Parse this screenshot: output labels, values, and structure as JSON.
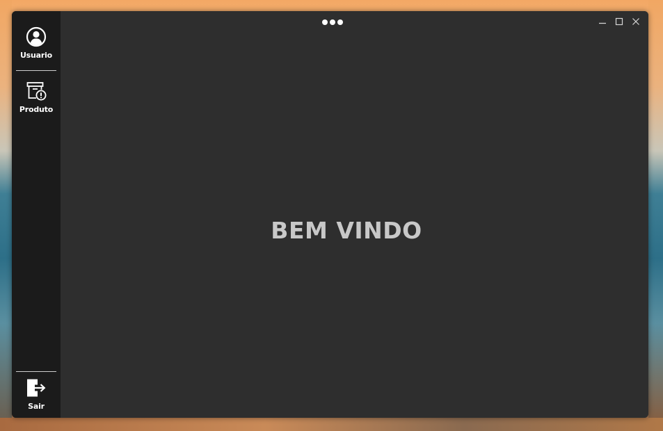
{
  "sidebar": {
    "items": [
      {
        "label": "Usuario",
        "icon": "user-circle-icon"
      },
      {
        "label": "Produto",
        "icon": "product-box-alert-icon"
      }
    ],
    "footer": {
      "label": "Sair",
      "icon": "logout-icon"
    }
  },
  "header": {
    "more_icon": "more-dots-icon",
    "window_controls": [
      "minimize-icon",
      "maximize-icon",
      "close-icon"
    ]
  },
  "main": {
    "welcome_text": "BEM VINDO"
  },
  "colors": {
    "sidebar_bg": "#1b1b1b",
    "content_bg": "#2e2e2e",
    "welcome_text": "#c8c8c8",
    "icon": "#ffffff"
  }
}
